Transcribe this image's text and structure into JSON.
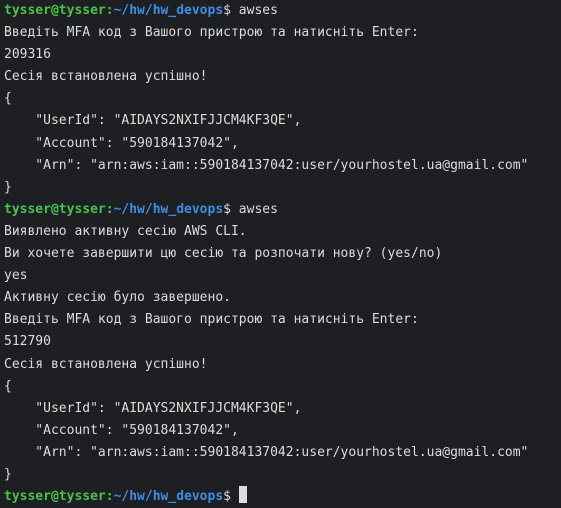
{
  "colors": {
    "background": "#1e1f22",
    "foreground": "#dcdcdc",
    "user_host": "#49c34a",
    "path": "#3f8de3"
  },
  "prompt": {
    "user_host": "tysser@tysser",
    "separator": ":",
    "path": "~/hw/hw_devops",
    "symbol": "$"
  },
  "lines": {
    "l01_cmd": " awses",
    "l02": "Введіть MFA код з Вашого пристрою та натисніть Enter:",
    "l03": "209316",
    "l04": "Сесія встановлена успішно!",
    "l05": "{",
    "l06": "    \"UserId\": \"AIDAYS2NXIFJJCM4KF3QE\",",
    "l07": "    \"Account\": \"590184137042\",",
    "l08": "    \"Arn\": \"arn:aws:iam::590184137042:user/yourhostel.ua@gmail.com\"",
    "l09": "}",
    "l10_cmd": " awses",
    "l11": "Виявлено активну сесію AWS CLI.",
    "l12": "Ви хочете завершити цю сесію та розпочати нову? (yes/no)",
    "l13": "yes",
    "l14": "Активну сесію було завершено.",
    "l15": "Введіть MFA код з Вашого пристрою та натисніть Enter:",
    "l16": "512790",
    "l17": "Сесія встановлена успішно!",
    "l18": "{",
    "l19": "    \"UserId\": \"AIDAYS2NXIFJJCM4KF3QE\",",
    "l20": "    \"Account\": \"590184137042\",",
    "l21": "    \"Arn\": \"arn:aws:iam::590184137042:user/yourhostel.ua@gmail.com\"",
    "l22": "}",
    "l23_cmd": " "
  }
}
